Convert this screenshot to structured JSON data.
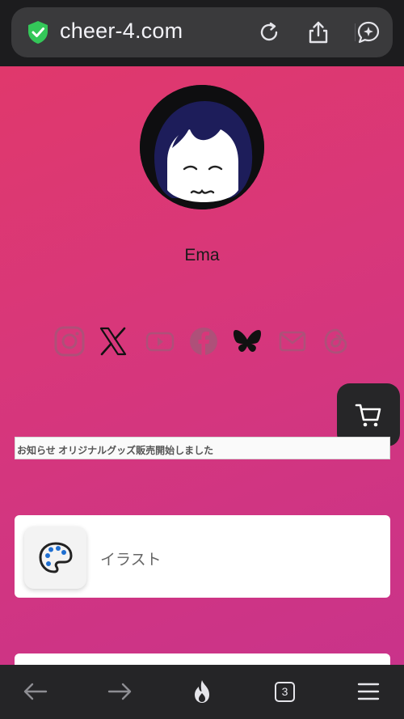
{
  "browser": {
    "url": "cheer-4.com",
    "tab_count": "3"
  },
  "profile": {
    "name": "Ema"
  },
  "social": [
    "instagram-icon",
    "x-icon",
    "youtube-icon",
    "facebook-icon",
    "bluesky-icon",
    "mail-icon",
    "threads-icon"
  ],
  "notice": {
    "text": "お知らせ オリジナルグッズ販売開始しました"
  },
  "links": [
    {
      "label": "イラスト",
      "icon": "palette-icon"
    }
  ],
  "colors": {
    "gradient_start": "#e0386c",
    "gradient_end": "#c9338a",
    "browser_bg": "#1c1c1e"
  }
}
